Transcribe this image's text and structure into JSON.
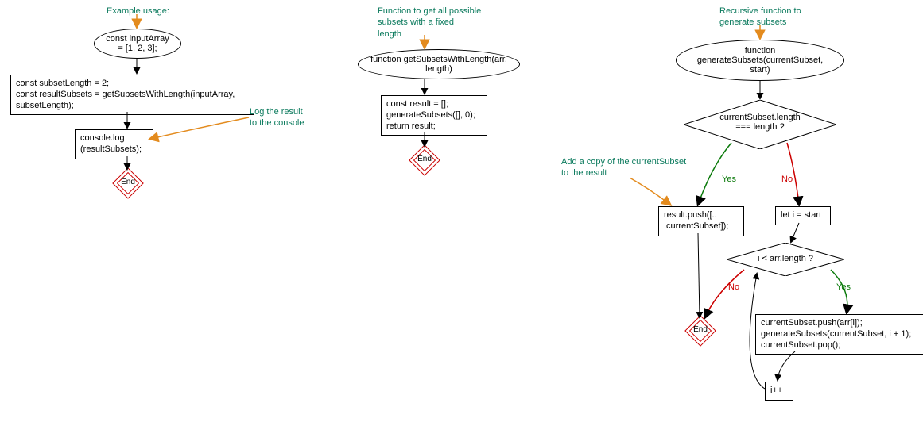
{
  "lane1": {
    "comment": "Example usage:",
    "start": "const inputArray\n= [1, 2, 3];",
    "block1": "const subsetLength = 2;\nconst resultSubsets = getSubsetsWithLength(inputArray,\nsubsetLength);",
    "block2": "console.log\n(resultSubsets);",
    "note": "Log the result\nto the console",
    "end": "End"
  },
  "lane2": {
    "comment": "Function to get all possible\nsubsets with a fixed\nlength",
    "start": "function getSubsetsWithLength(arr,\nlength)",
    "block1": "const result = [];\ngenerateSubsets([], 0);\nreturn result;",
    "end": "End"
  },
  "lane3": {
    "comment": "Recursive function to\ngenerate subsets",
    "start": "function\ngenerateSubsets(currentSubset,\nstart)",
    "decision1": "currentSubset.length\n=== length ?",
    "note": "Add a copy of the currentSubset\nto the result",
    "yesBlock": "result.push([..\n.currentSubset]);",
    "noBlock": "let i = start",
    "decision2": "i < arr.length ?",
    "loopBody": "currentSubset.push(arr[i]);\ngenerateSubsets(currentSubset, i + 1);\ncurrentSubset.pop();",
    "increment": "i++",
    "end": "End",
    "yes": "Yes",
    "no": "No"
  }
}
